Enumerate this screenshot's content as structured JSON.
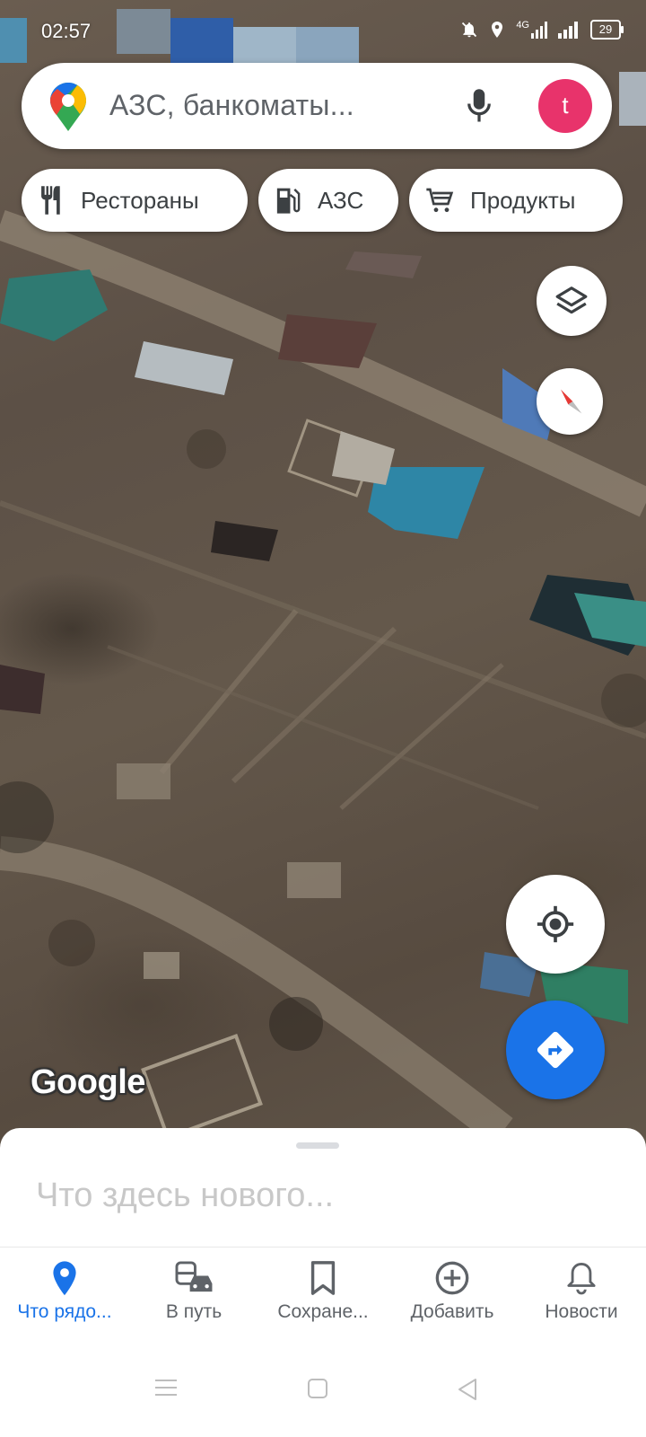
{
  "status_bar": {
    "time": "02:57",
    "network": "4G",
    "battery": "29"
  },
  "search": {
    "placeholder": "АЗС, банкоматы...",
    "avatar_letter": "t",
    "avatar_color": "#e8336b"
  },
  "chips": [
    {
      "label": "Рестораны",
      "icon": "fork-knife-icon"
    },
    {
      "label": "АЗС",
      "icon": "gas-station-icon"
    },
    {
      "label": "Продукты",
      "icon": "shopping-cart-icon"
    }
  ],
  "map": {
    "attribution": "Google",
    "layer": "satellite"
  },
  "sheet": {
    "title": "Что здесь нового..."
  },
  "nav": {
    "items": [
      {
        "label": "Что рядо...",
        "icon": "place-pin-icon",
        "active": true
      },
      {
        "label": "В путь",
        "icon": "commute-icon",
        "active": false
      },
      {
        "label": "Сохране...",
        "icon": "bookmark-icon",
        "active": false
      },
      {
        "label": "Добавить",
        "icon": "add-circle-icon",
        "active": false
      },
      {
        "label": "Новости",
        "icon": "bell-icon",
        "active": false
      }
    ]
  },
  "colors": {
    "accent": "#1a73e8",
    "chip_text": "#3c4043"
  }
}
